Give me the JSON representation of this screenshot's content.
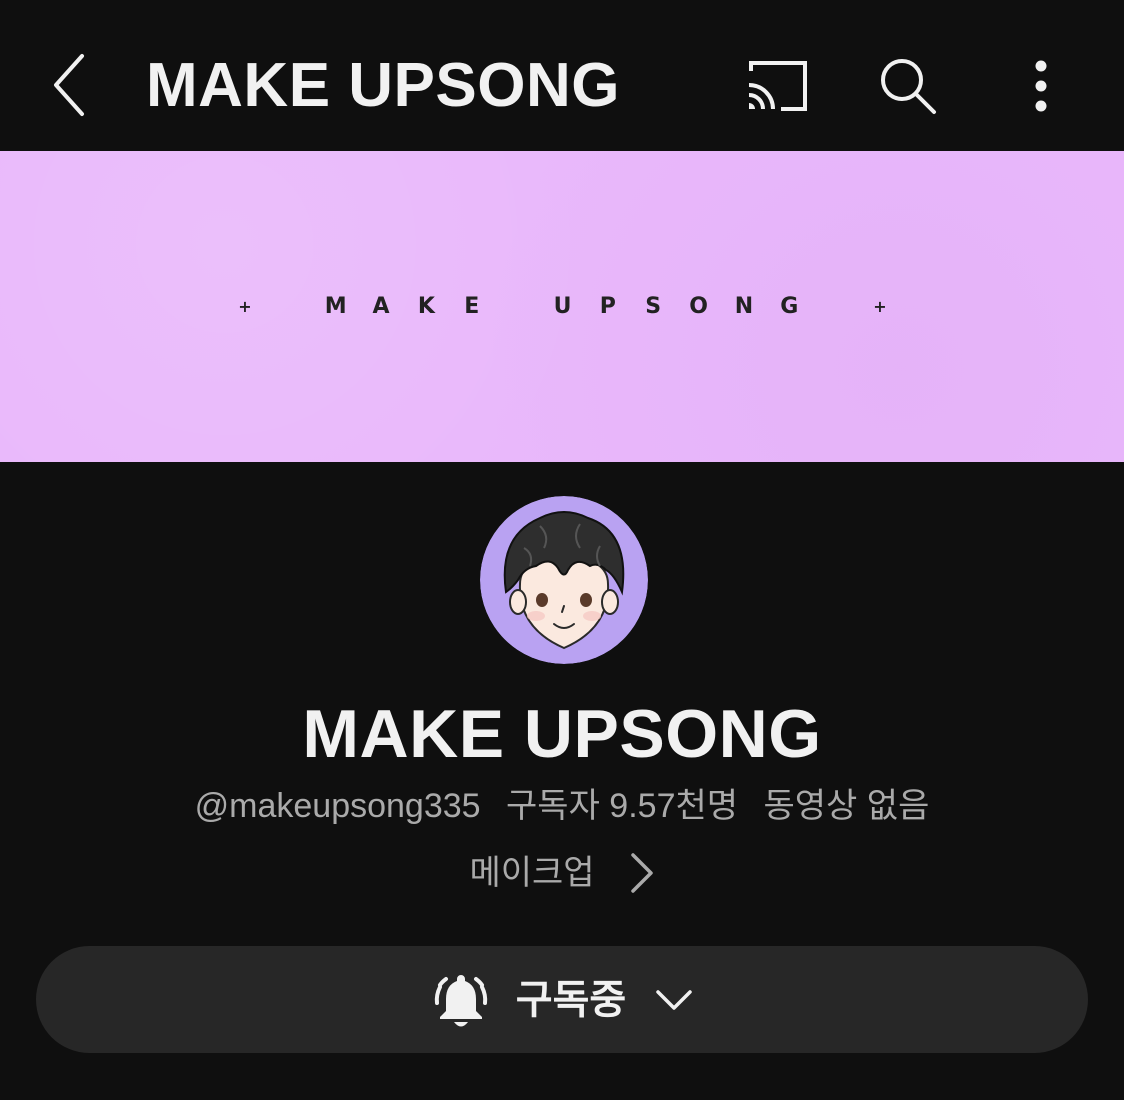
{
  "appbar": {
    "title": "MAKE UPSONG",
    "icons": [
      "back-icon",
      "cast-icon",
      "search-icon",
      "more-vert-icon"
    ]
  },
  "banner": {
    "text": "+ MAKE UPSONG +",
    "color": "#e9b8fb"
  },
  "channel": {
    "name": "MAKE UPSONG",
    "handle": "@makeupsong335",
    "subscribers": "구독자 9.57천명",
    "videos": "동영상 없음",
    "description": "메이크업",
    "avatar_bg": "#b9a2f2"
  },
  "subscribe": {
    "label": "구독중",
    "icon": "bell-ringing-icon"
  }
}
